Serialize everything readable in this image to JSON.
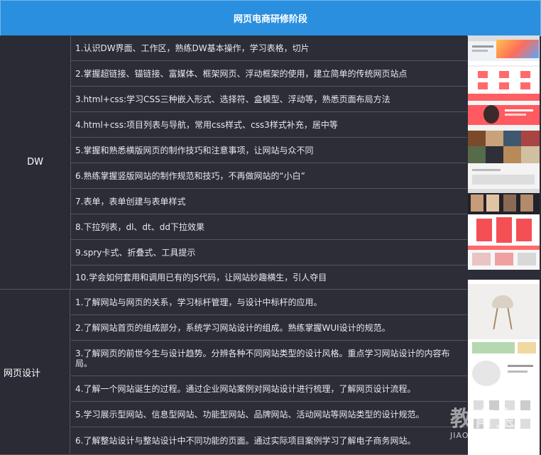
{
  "header": {
    "title": "网页电商研修阶段"
  },
  "sections": [
    {
      "name": "DW",
      "items": [
        "1.认识DW界面、工作区，熟练DW基本操作，学习表格，切片",
        "2.掌握超链接、锚链接、富媒体、框架网页、浮动框架的使用，建立简单的传统网页站点",
        "3.html+css:学习CSS三种嵌入形式、选择符、盒模型、浮动等，熟悉页面布局方法",
        "4.html+css:项目列表与导航，常用css样式、css3样式补充，居中等",
        "5.掌握和熟悉横版网页的制作技巧和注意事项，让网站与众不同",
        "6.熟练掌握竖版网站的制作规范和技巧，不再做网站的“小白”",
        "7.表单，表单创建与表单样式",
        "8.下拉列表，dl、dt、dd下拉效果",
        "9.spry卡式、折叠式、工具提示",
        "10.学会如何套用和调用已有的JS代码，让网站妙趣横生，引人夺目"
      ]
    },
    {
      "name": "网页设计",
      "items": [
        "1.了解网站与网页的关系，学习标杆管理，与设计中标杆的应用。",
        "2.了解网站首页的组成部分，系统学习网站设计的组成。熟练掌握WUI设计的规范。",
        "3.了解网页的前世今生与设计趋势。分辨各种不同网站类型的设计风格。重点学习网站设计的内容布局。",
        "4.了解一个网站诞生的过程。通过企业网站案例对网站设计进行梳理，了解网页设计流程。",
        "5.学习展示型网站、信息型网站、功能型网站、品牌网站、活动网站等网站类型的设计规范。",
        "6.了解整站设计与整站设计中不同功能的页面。通过实际项目案例学习了解电子商务网站。"
      ]
    }
  ],
  "watermark": {
    "main": "教育宝",
    "sub": "JIAOYUBAO.CN"
  },
  "colors": {
    "header": "#2a8fdf",
    "body": "#2b2b35",
    "border": "#55555f"
  }
}
